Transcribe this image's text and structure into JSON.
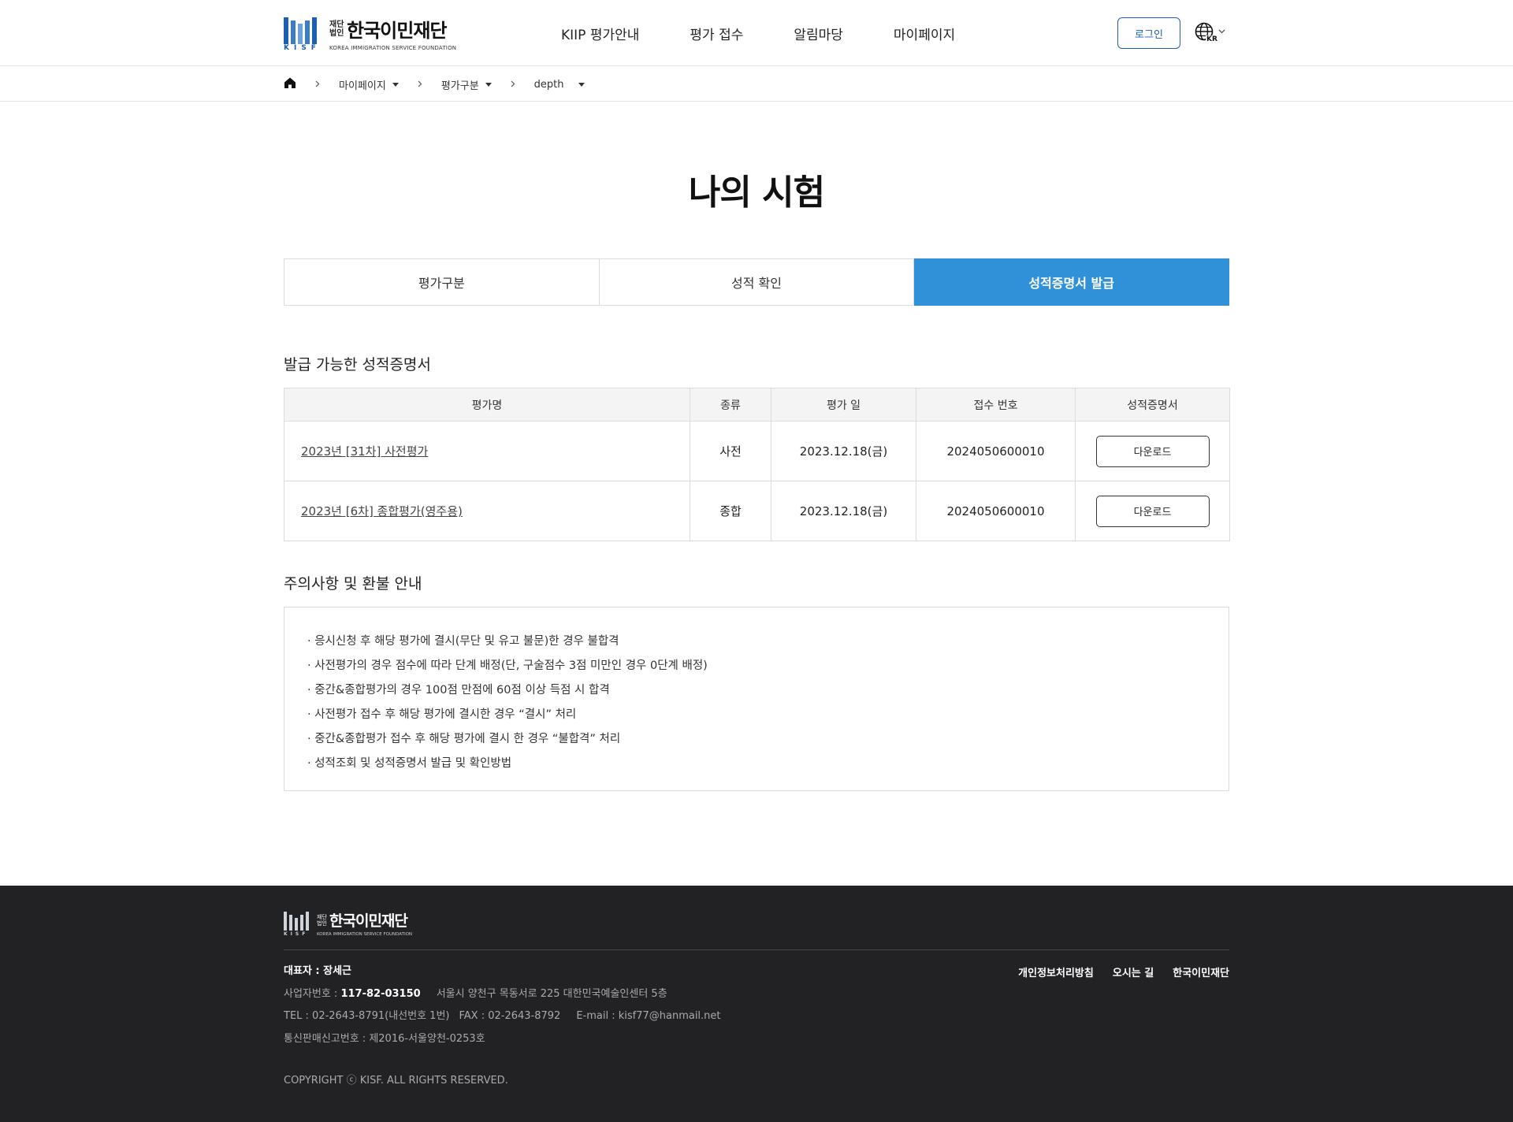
{
  "header": {
    "logo": {
      "small_top": "재단",
      "small_bottom": "법인",
      "name": "한국이민재단",
      "sub": "KOREA IMMIGRATION SERVICE FOUNDATION",
      "mark_text": "KISF"
    },
    "nav": [
      "KIIP 평가안내",
      "평가 접수",
      "알림마당",
      "마이페이지"
    ],
    "login_label": "로그인",
    "lang_code": "KR"
  },
  "breadcrumb": {
    "items": [
      "마이페이지",
      "평가구분",
      "depth"
    ]
  },
  "page_title": "나의 시험",
  "tabs": [
    {
      "label": "평가구분",
      "active": false
    },
    {
      "label": "성적 확인",
      "active": false
    },
    {
      "label": "성적증명서 발급",
      "active": true
    }
  ],
  "certificates": {
    "title": "발급 가능한 성적증명서",
    "columns": [
      "평가명",
      "종류",
      "평가 일",
      "접수 번호",
      "성적증명서"
    ],
    "rows": [
      {
        "name": "2023년 [31차] 사전평가",
        "type": "사전",
        "date": "2023.12.18(금)",
        "receipt": "2024050600010",
        "action": "다운로드"
      },
      {
        "name": "2023년 [6차] 종합평가(영주용)",
        "type": "종합",
        "date": "2023.12.18(금)",
        "receipt": "2024050600010",
        "action": "다운로드"
      }
    ]
  },
  "notice": {
    "title": "주의사항 및 환불 안내",
    "items": [
      "· 응시신청 후 해당 평가에 결시(무단 및 유고 불문)한 경우 불합격",
      "· 사전평가의 경우 점수에 따라 단계 배정(단, 구술점수 3점 미만인 경우 0단계 배정)",
      "· 중간&종합평가의 경우 100점 만점에 60점 이상 득점 시 합격",
      "· 사전평가 접수 후 해당 평가에 결시한 경우 “결시” 처리",
      "· 중간&종합평가 접수 후 해당 평가에 결시 한 경우 “불합격” 처리",
      "· 성적조회 및 성적증명서 발급 및 확인방법"
    ]
  },
  "footer": {
    "logo": {
      "small_top": "재단",
      "small_bottom": "법인",
      "name": "한국이민재단",
      "sub": "KOREA IMMIGRATION SERVICE FOUNDATION",
      "mark_text": "KISF"
    },
    "rep_label": "대표자 : 장세근",
    "biz_label": "사업자번호 : ",
    "biz_no": "117-82-03150",
    "address": "서울시 양천구 목동서로 225 대한민국예술인센터 5층",
    "tel": "TEL : 02-2643-8791(내선번호 1번)",
    "fax": "FAX : 02-2643-8792",
    "email": "E-mail : kisf77@hanmail.net",
    "mail_order": "통신판매신고번호 : 제2016-서울양천-0253호",
    "copyright": "COPYRIGHT ⓒ KISF. ALL RIGHTS RESERVED.",
    "links": [
      "개인정보처리방침",
      "오시는 길",
      "한국이민재단"
    ]
  },
  "colors": {
    "accent": "#3090d8",
    "brand": "#1f5fb1",
    "footer_bg": "#222225"
  }
}
